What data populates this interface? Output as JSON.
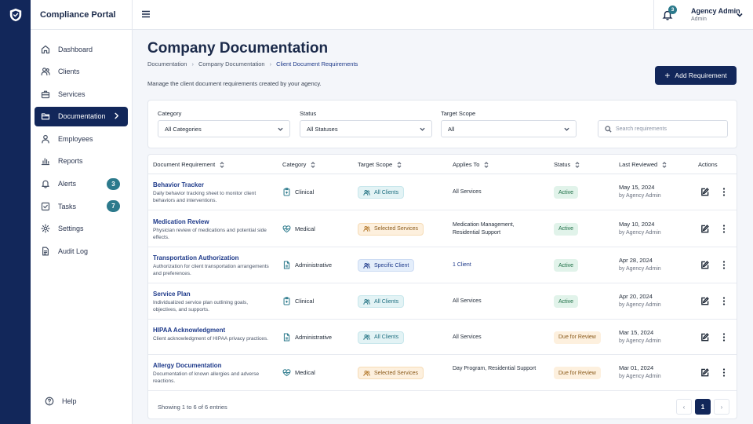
{
  "app": {
    "brand": "Compliance Portal"
  },
  "sidebar": {
    "items": [
      {
        "label": "Dashboard",
        "icon": "home-icon"
      },
      {
        "label": "Clients",
        "icon": "users-icon"
      },
      {
        "label": "Services",
        "icon": "briefcase-icon"
      },
      {
        "label": "Documentation",
        "icon": "folder-icon",
        "active": true
      },
      {
        "label": "Employees",
        "icon": "user-icon"
      },
      {
        "label": "Reports",
        "icon": "bar-chart-icon"
      },
      {
        "label": "Alerts",
        "icon": "bell-icon",
        "badge": "3"
      },
      {
        "label": "Tasks",
        "icon": "checkbox-icon",
        "badge": "7"
      },
      {
        "label": "Settings",
        "icon": "gear-icon"
      },
      {
        "label": "Audit Log",
        "icon": "document-icon"
      }
    ],
    "help": "Help"
  },
  "topbar": {
    "notification_count": "3",
    "user_name": "Agency Admin",
    "user_role": "Admin"
  },
  "header": {
    "title": "Company Documentation",
    "breadcrumb": [
      "Documentation",
      "Company Documentation",
      "Client Document Requirements"
    ],
    "subtitle": "Manage the client document requirements created by your agency.",
    "add_button": "Add Requirement"
  },
  "filters": {
    "category": {
      "label": "Category",
      "value": "All Categories"
    },
    "status": {
      "label": "Status",
      "value": "All Statuses"
    },
    "scope": {
      "label": "Target Scope",
      "value": "All"
    },
    "search_placeholder": "Search requirements"
  },
  "table": {
    "headers": [
      "Document Requirement",
      "Category",
      "Target Scope",
      "Applies To",
      "Status",
      "Last Reviewed",
      "Actions"
    ],
    "rows": [
      {
        "title": "Behavior Tracker",
        "desc": "Daily behavior tracking sheet to monitor client behaviors and interventions.",
        "category": "Clinical",
        "category_icon": "clipboard-icon",
        "scope": "All Clients",
        "scope_kind": "all",
        "applies": "All Services",
        "status": "Active",
        "status_kind": "active",
        "date": "May 15, 2024",
        "by": "by Agency Admin"
      },
      {
        "title": "Medication Review",
        "desc": "Physician review of medications and potential side effects.",
        "category": "Medical",
        "category_icon": "heart-pulse-icon",
        "scope": "Selected Services",
        "scope_kind": "sel",
        "applies": "Medication Management, Residential Support",
        "status": "Active",
        "status_kind": "active",
        "date": "May 10, 2024",
        "by": "by Agency Admin"
      },
      {
        "title": "Transportation Authorization",
        "desc": "Authorization for client transportation arrangements and preferences.",
        "category": "Administrative",
        "category_icon": "file-icon",
        "scope": "Specific Client",
        "scope_kind": "spec",
        "applies": "1 Client",
        "applies_link": true,
        "status": "Active",
        "status_kind": "active",
        "date": "Apr 28, 2024",
        "by": "by Agency Admin"
      },
      {
        "title": "Service Plan",
        "desc": "Individualized service plan outlining goals, objectives, and supports.",
        "category": "Clinical",
        "category_icon": "clipboard-icon",
        "scope": "All Clients",
        "scope_kind": "all",
        "applies": "All Services",
        "status": "Active",
        "status_kind": "active",
        "date": "Apr 20, 2024",
        "by": "by Agency Admin"
      },
      {
        "title": "HIPAA Acknowledgment",
        "desc": "Client acknowledgment of HIPAA privacy practices.",
        "category": "Administrative",
        "category_icon": "file-icon",
        "scope": "All Clients",
        "scope_kind": "all",
        "applies": "All Services",
        "status": "Due for Review",
        "status_kind": "review",
        "date": "Mar 15, 2024",
        "by": "by Agency Admin"
      },
      {
        "title": "Allergy Documentation",
        "desc": "Documentation of known allergies and adverse reactions.",
        "category": "Medical",
        "category_icon": "heart-pulse-icon",
        "scope": "Selected Services",
        "scope_kind": "sel",
        "applies": "Day Program, Residential Support",
        "status": "Due for Review",
        "status_kind": "review",
        "date": "Mar 01, 2024",
        "by": "by Agency Admin"
      }
    ]
  },
  "pagination": {
    "showing": "Showing 1 to 6 of 6 entries",
    "prev": "‹",
    "current": "1",
    "next": "›"
  }
}
